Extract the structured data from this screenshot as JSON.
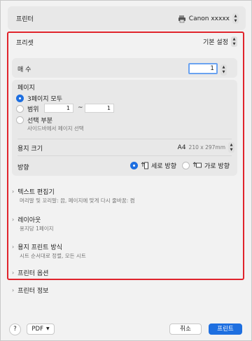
{
  "printer": {
    "label": "프린터",
    "value": "Canon xxxxx"
  },
  "preset": {
    "label": "프리셋",
    "value": "기본 설정"
  },
  "copies": {
    "label": "매 수",
    "value": "1"
  },
  "pages": {
    "label": "페이지",
    "all_label": "3페이지 모두",
    "range_label": "범위",
    "range_from": "1",
    "range_sep": "~",
    "range_to": "1",
    "selection_label": "선택 부분",
    "selection_sub": "사이드바에서 페이지 선택"
  },
  "paper_size": {
    "label": "용지 크기",
    "value": "A4",
    "dims": "210 x 297mm"
  },
  "orientation": {
    "label": "방향",
    "portrait": "세로 방향",
    "landscape": "가로 방향"
  },
  "sections": [
    {
      "title": "텍스트 편집기",
      "sub": "머리말 및 꼬리말: 끔, 페이지에 맞게 다시 줄바꿈: 켬"
    },
    {
      "title": "레이아웃",
      "sub": "용지당 1페이지"
    },
    {
      "title": "용지 프린트 방식",
      "sub": "시트 순서대로 정렬, 모든 시트"
    },
    {
      "title": "프린터 옵션",
      "sub": ""
    },
    {
      "title": "프린터 정보",
      "sub": ""
    }
  ],
  "footer": {
    "help": "?",
    "pdf": "PDF",
    "cancel": "취소",
    "print": "프린트"
  },
  "colors": {
    "accent": "#1e6fe0",
    "highlight": "#e0242c"
  }
}
